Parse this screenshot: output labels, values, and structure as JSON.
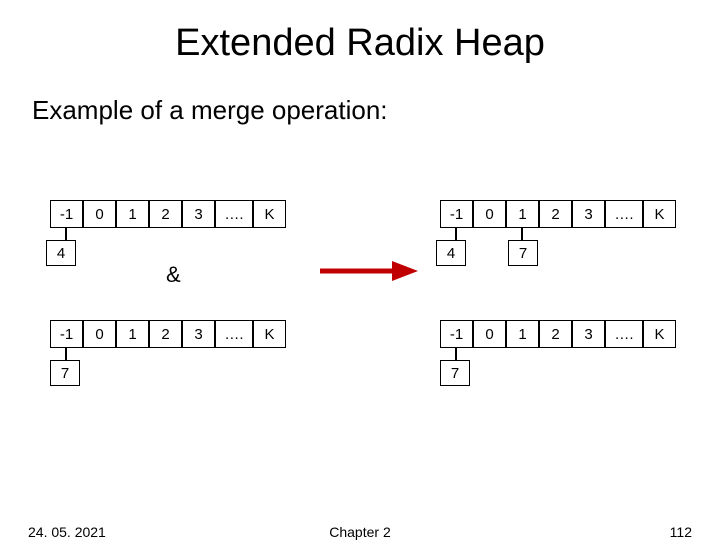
{
  "title": "Extended Radix Heap",
  "subtitle": "Example of a merge operation:",
  "heap_labels": [
    "-1",
    "0",
    "1",
    "2",
    "3",
    "….",
    "K"
  ],
  "left_top_node": "4",
  "left_bottom_node": "7",
  "amp": "&",
  "right_top_nodes": {
    "a": "4",
    "b": "7"
  },
  "right_bottom_node": "7",
  "footer": {
    "date": "24. 05. 2021",
    "chapter": "Chapter 2",
    "page": "112"
  },
  "chart_data": {
    "type": "diagram",
    "description": "Merge of two radix-heap bucket arrays into two result arrays",
    "bucket_labels": [
      "-1",
      "0",
      "1",
      "2",
      "3",
      "….",
      "K"
    ],
    "inputs": [
      {
        "buckets": [
          "-1",
          "0",
          "1",
          "2",
          "3",
          "….",
          "K"
        ],
        "attached": {
          "-1": [
            4
          ]
        }
      },
      {
        "buckets": [
          "-1",
          "0",
          "1",
          "2",
          "3",
          "….",
          "K"
        ],
        "attached": {
          "-1": [
            7
          ]
        }
      }
    ],
    "outputs": [
      {
        "buckets": [
          "-1",
          "0",
          "1",
          "2",
          "3",
          "….",
          "K"
        ],
        "attached": {
          "-1": [
            4
          ],
          "1": [
            7
          ]
        }
      },
      {
        "buckets": [
          "-1",
          "0",
          "1",
          "2",
          "3",
          "….",
          "K"
        ],
        "attached": {
          "-1": [
            7
          ]
        }
      }
    ]
  }
}
